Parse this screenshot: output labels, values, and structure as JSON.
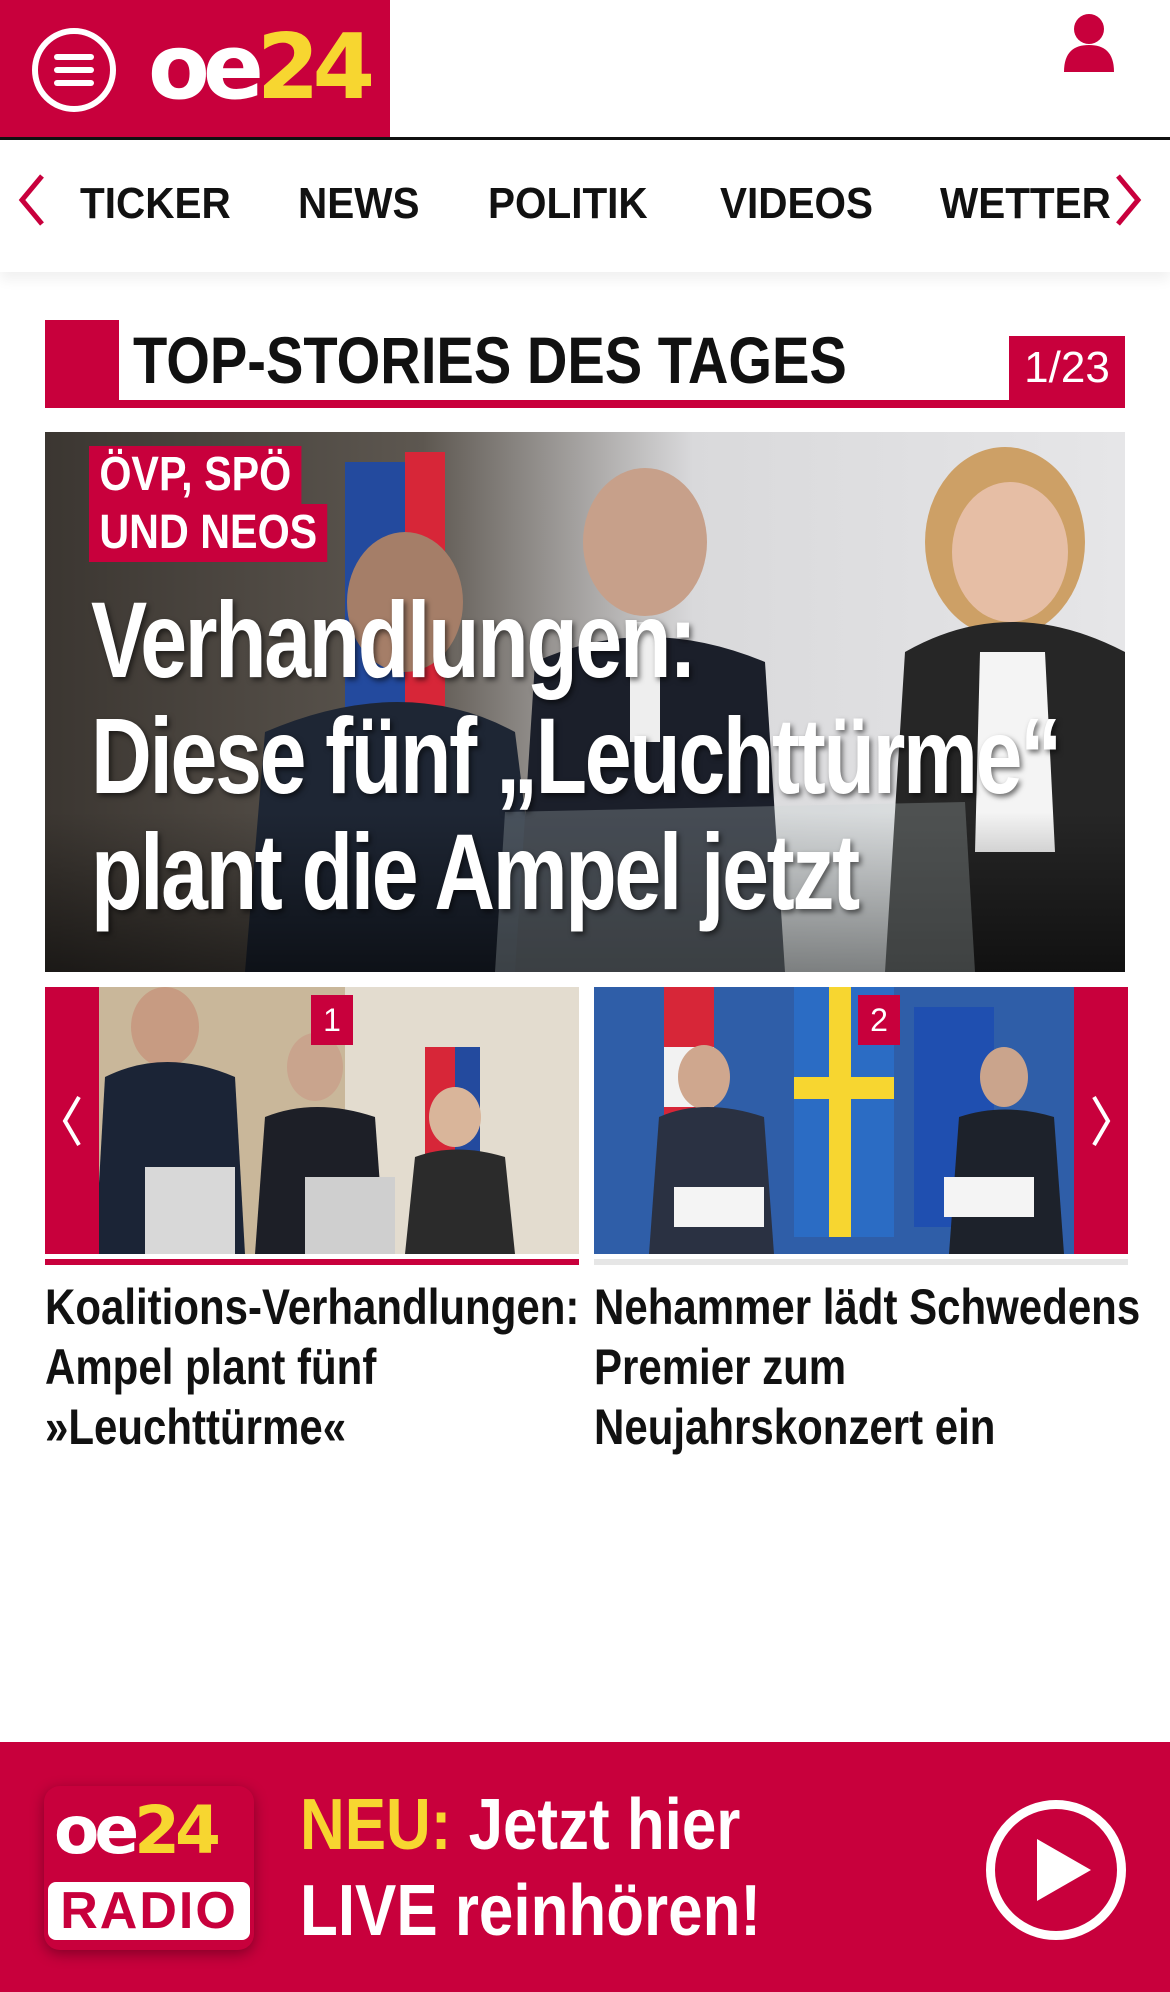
{
  "header": {
    "logo_oe": "oe",
    "logo_24": "24"
  },
  "nav": {
    "items": [
      {
        "label": "TICKER"
      },
      {
        "label": "NEWS"
      },
      {
        "label": "POLITIK"
      },
      {
        "label": "VIDEOS"
      },
      {
        "label": "WETTER"
      }
    ]
  },
  "section": {
    "title": "TOP-STORIES DES TAGES",
    "counter": "1/23"
  },
  "hero": {
    "kicker_line1": "ÖVP, SPÖ",
    "kicker_line2": "UND NEOS",
    "title_line1": "Verhandlungen:",
    "title_line2": "Diese fünf „Leuchttürme“",
    "title_line3": "plant die Ampel jetzt"
  },
  "carousel": {
    "cards": [
      {
        "number": "1",
        "title_line1": "Koalitions-Verhandlungen:",
        "title_line2": "Ampel plant fünf",
        "title_line3": "»Leuchttürme«"
      },
      {
        "number": "2",
        "title_line1": "Nehammer lädt Schwedens",
        "title_line2": "Premier zum",
        "title_line3": "Neujahrskonzert ein"
      }
    ]
  },
  "radio": {
    "logo_oe": "oe",
    "logo_24": "24",
    "logo_radio": "RADIO",
    "neu": "NEU:",
    "line1_rest": " Jetzt hier",
    "line2": "LIVE reinhören!"
  },
  "colors": {
    "brand_red": "#c8003c",
    "brand_yellow": "#f7d630"
  },
  "icons": [
    "menu-icon",
    "user-icon",
    "chevron-left-icon",
    "chevron-right-icon",
    "play-icon"
  ]
}
